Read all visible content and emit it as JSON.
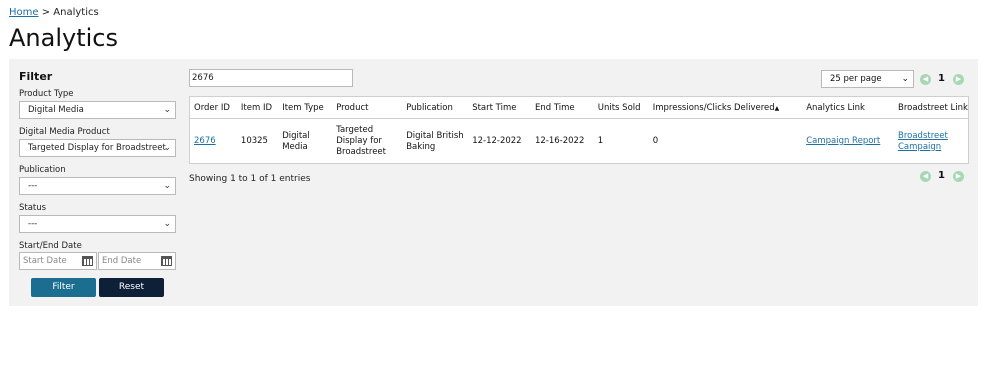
{
  "breadcrumb": {
    "home": "Home",
    "separator": ">",
    "current": "Analytics"
  },
  "page_title": "Analytics",
  "filter": {
    "title": "Filter",
    "product_type_label": "Product Type",
    "product_type_value": "Digital Media",
    "digital_media_product_label": "Digital Media Product",
    "digital_media_product_value": "Targeted Display for Broadstreet",
    "publication_label": "Publication",
    "publication_value": "---",
    "status_label": "Status",
    "status_value": "---",
    "date_label": "Start/End Date",
    "start_placeholder": "Start Date",
    "end_placeholder": "End Date",
    "filter_button": "Filter",
    "reset_button": "Reset"
  },
  "search": {
    "value": "2676"
  },
  "per_page": {
    "value": "25 per page"
  },
  "pagination": {
    "current": "1",
    "prev_icon": "chevron-left-icon",
    "next_icon": "chevron-right-icon"
  },
  "table": {
    "headers": [
      "Order ID",
      "Item ID",
      "Item Type",
      "Product",
      "Publication",
      "Start Time",
      "End Time",
      "Units Sold",
      "Impressions/Clicks Delivered",
      "Analytics Link",
      "Broadstreet Link"
    ],
    "sort_indicator": "▲",
    "rows": [
      {
        "order_id": "2676",
        "item_id": "10325",
        "item_type": "Digital Media",
        "product": "Targeted Display for Broadstreet",
        "publication": "Digital British Baking",
        "start_time": "12-12-2022",
        "end_time": "12-16-2022",
        "units_sold": "1",
        "impressions": "0",
        "analytics_link": "Campaign Report",
        "broadstreet_link": "Broadstreet Campaign"
      }
    ]
  },
  "showing_text": "Showing 1 to 1 of 1 entries",
  "colors": {
    "filter_button": "#1b6e8f",
    "reset_button": "#0e1f38",
    "link": "#1d6fa5",
    "pagination_arrow": "#a7d8b3",
    "panel_bg": "#f2f2f2"
  }
}
